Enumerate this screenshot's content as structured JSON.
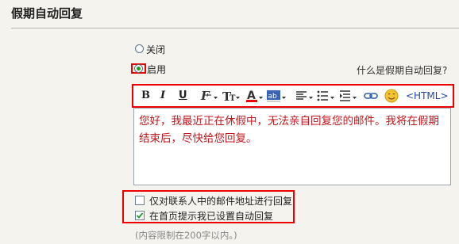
{
  "section": {
    "title": "假期自动回复"
  },
  "status_radios": [
    {
      "label": "关闭",
      "checked": false
    },
    {
      "label": "启用",
      "checked": true
    }
  ],
  "help_link": "什么是假期自动回复?",
  "toolbar": {
    "bold": "B",
    "italic": "I",
    "underline": "U",
    "html_label": "<HTML>"
  },
  "editor": {
    "content": "您好，我最近正在休假中，无法亲自回复您的邮件。我将在假期结束后，尽快给您回复。"
  },
  "options": [
    {
      "label": "仅对联系人中的邮件地址进行回复",
      "checked": false
    },
    {
      "label": "在首页提示我已设置自动回复",
      "checked": true
    }
  ],
  "limit_note": "(内容限制在200字以内。)",
  "colors": {
    "highlight_box": "#e00000",
    "editor_text": "#c0161b"
  }
}
